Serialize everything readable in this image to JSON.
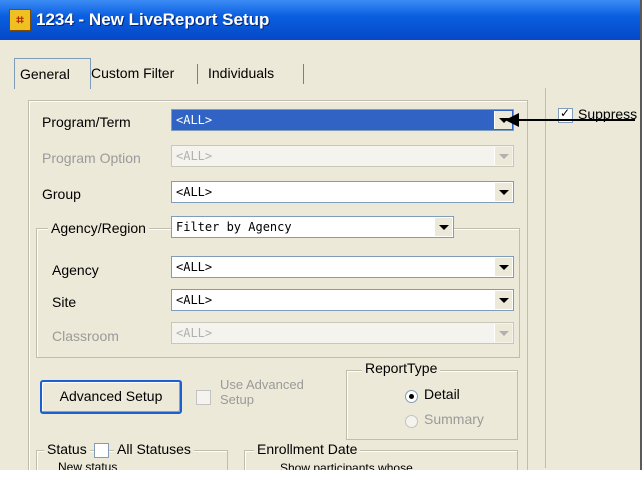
{
  "window": {
    "title": "1234 - New LiveReport Setup",
    "icon": "app-icon"
  },
  "tabs": [
    {
      "label": "General",
      "active": true
    },
    {
      "label": "Custom Filter",
      "active": false
    },
    {
      "label": "Individuals",
      "active": false
    }
  ],
  "fields": {
    "program_term": {
      "label": "Program/Term",
      "value": "<ALL>"
    },
    "program_option": {
      "label": "Program Option",
      "value": "<ALL>"
    },
    "group": {
      "label": "Group",
      "value": "<ALL>"
    }
  },
  "agency_group": {
    "label": "Agency/Region",
    "filter_value": "Filter by Agency",
    "agency": {
      "label": "Agency",
      "value": "<ALL>"
    },
    "site": {
      "label": "Site",
      "value": "<ALL>"
    },
    "classroom": {
      "label": "Classroom",
      "value": "<ALL>"
    }
  },
  "advanced": {
    "button_label": "Advanced Setup",
    "checkbox_label": "Use Advanced Setup"
  },
  "report_type": {
    "label": "ReportType",
    "detail": "Detail",
    "summary": "Summary"
  },
  "status": {
    "label": "Status",
    "all_statuses": "All Statuses",
    "item": "New status"
  },
  "enrollment": {
    "label": "Enrollment Date",
    "text": "Show participants whose"
  },
  "right_panel": {
    "checkbox_label": "Suppress"
  },
  "colors": {
    "title_bar": "#0a5fe0",
    "selection": "#3163c5",
    "window_bg": "#ece9d8"
  }
}
